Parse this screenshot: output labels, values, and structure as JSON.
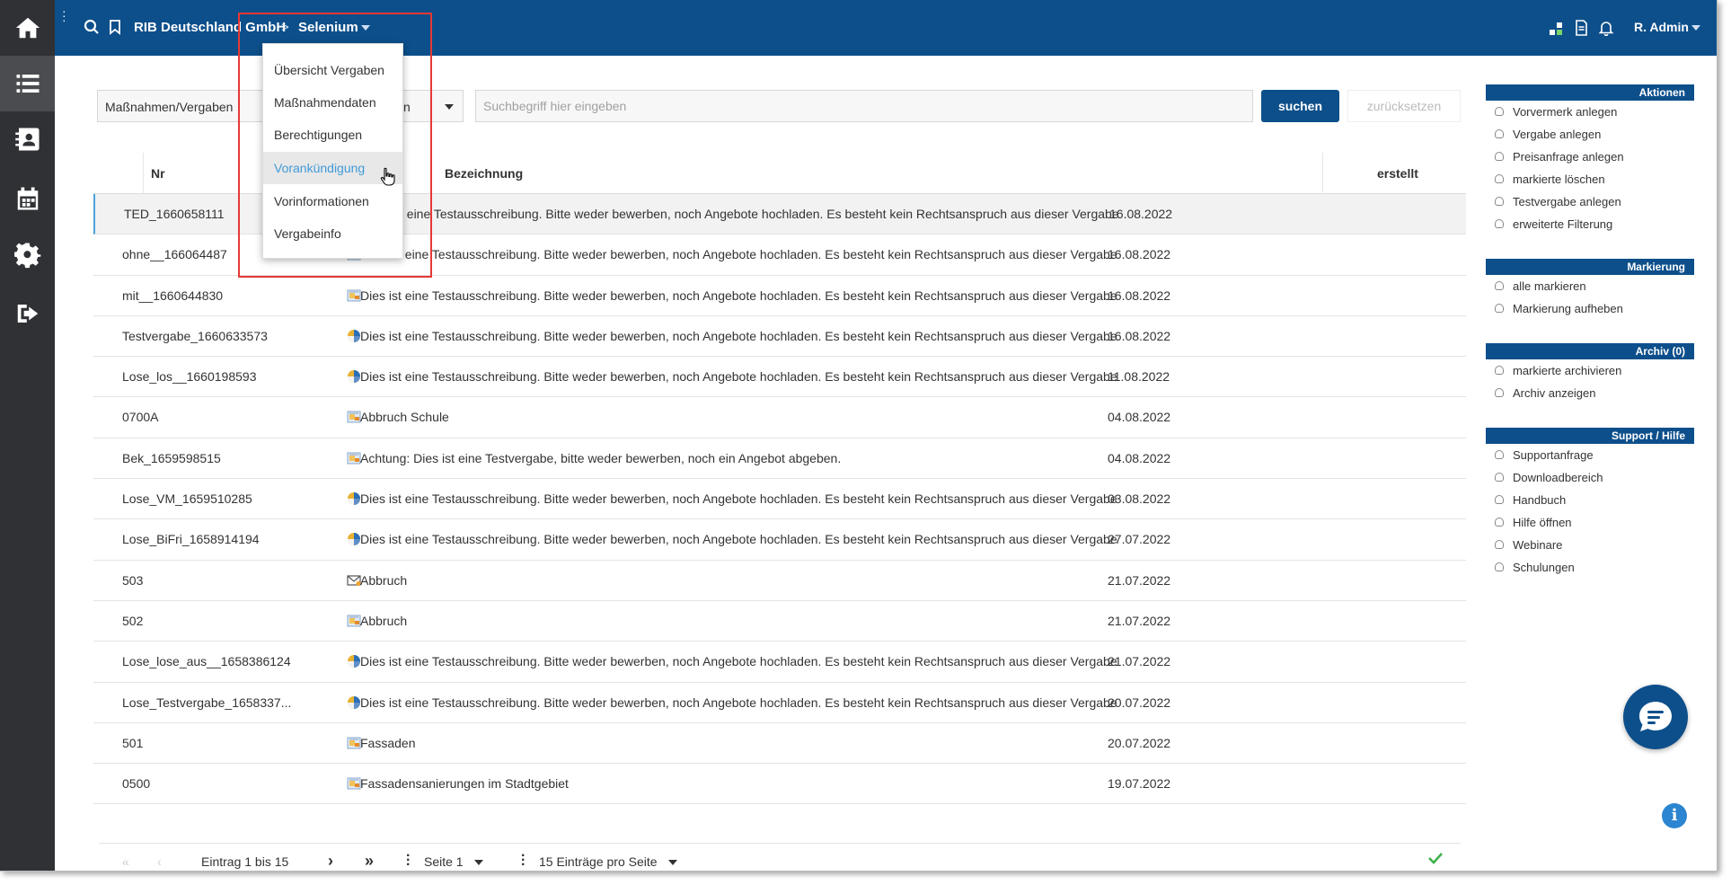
{
  "header": {
    "org": "RIB Deutschland GmbH",
    "separator": ">",
    "context": "Selenium",
    "user": "R. Admin"
  },
  "toolbar": {
    "filter_value": "Maßnahmen/Vergaben",
    "filter_value_tail": "n",
    "search_placeholder": "Suchbegriff hier eingeben",
    "search_label": "suchen",
    "reset_label": "zurücksetzen"
  },
  "dropdown": {
    "items": [
      "Übersicht Vergaben",
      "Maßnahmendaten",
      "Berechtigungen",
      "Vorankündigung",
      "Vorinformationen",
      "Vergabeinfo"
    ],
    "hovered": "Vorankündigung"
  },
  "table": {
    "columns": {
      "nr": "Nr",
      "bezeichnung": "Bezeichnung",
      "erstellt": "erstellt"
    },
    "rows": [
      {
        "nr": "TED_1660658111",
        "icon": "pie-icon",
        "bezeichnung": "Dies ist eine Testausschreibung. Bitte weder bewerben, noch Angebote hochladen. Es besteht kein Rechtsanspruch aus dieser Vergabe",
        "erstellt": "16.08.2022"
      },
      {
        "nr": "ohne__166064487",
        "icon": "folder-icon",
        "bezeichnung": "Dies ist eine Testausschreibung. Bitte weder bewerben, noch Angebote hochladen. Es besteht kein Rechtsanspruch aus dieser Vergabe",
        "erstellt": "16.08.2022"
      },
      {
        "nr": "mit__1660644830",
        "icon": "folder-icon",
        "bezeichnung": "Dies ist eine Testausschreibung. Bitte weder bewerben, noch Angebote hochladen. Es besteht kein Rechtsanspruch aus dieser Vergabe",
        "erstellt": "16.08.2022"
      },
      {
        "nr": "Testvergabe_1660633573",
        "icon": "pie-icon",
        "bezeichnung": "Dies ist eine Testausschreibung. Bitte weder bewerben, noch Angebote hochladen. Es besteht kein Rechtsanspruch aus dieser Vergabe",
        "erstellt": "16.08.2022"
      },
      {
        "nr": "Lose_los__1660198593",
        "icon": "pie-icon",
        "bezeichnung": "Dies ist eine Testausschreibung. Bitte weder bewerben, noch Angebote hochladen. Es besteht kein Rechtsanspruch aus dieser Vergabe",
        "erstellt": "11.08.2022"
      },
      {
        "nr": "0700A",
        "icon": "folder-icon",
        "bezeichnung": "Abbruch Schule",
        "erstellt": "04.08.2022"
      },
      {
        "nr": "Bek_1659598515",
        "icon": "folder-icon",
        "bezeichnung": "Achtung: Dies ist eine Testvergabe, bitte weder bewerben, noch ein Angebot abgeben.",
        "erstellt": "04.08.2022"
      },
      {
        "nr": "Lose_VM_1659510285",
        "icon": "pie-icon",
        "bezeichnung": "Dies ist eine Testausschreibung. Bitte weder bewerben, noch Angebote hochladen. Es besteht kein Rechtsanspruch aus dieser Vergabe",
        "erstellt": "03.08.2022"
      },
      {
        "nr": "Lose_BiFri_1658914194",
        "icon": "pie-icon",
        "bezeichnung": "Dies ist eine Testausschreibung. Bitte weder bewerben, noch Angebote hochladen. Es besteht kein Rechtsanspruch aus dieser Vergabe",
        "erstellt": "27.07.2022"
      },
      {
        "nr": "503",
        "icon": "envelope-icon",
        "bezeichnung": "Abbruch",
        "erstellt": "21.07.2022"
      },
      {
        "nr": "502",
        "icon": "folder-icon",
        "bezeichnung": "Abbruch",
        "erstellt": "21.07.2022"
      },
      {
        "nr": "Lose_lose_aus__1658386124",
        "icon": "pie-icon",
        "bezeichnung": "Dies ist eine Testausschreibung. Bitte weder bewerben, noch Angebote hochladen. Es besteht kein Rechtsanspruch aus dieser Vergabe",
        "erstellt": "21.07.2022"
      },
      {
        "nr": "Lose_Testvergabe_1658337...",
        "icon": "pie-icon",
        "bezeichnung": "Dies ist eine Testausschreibung. Bitte weder bewerben, noch Angebote hochladen. Es besteht kein Rechtsanspruch aus dieser Vergabe",
        "erstellt": "20.07.2022"
      },
      {
        "nr": "501",
        "icon": "folder-icon",
        "bezeichnung": "Fassaden",
        "erstellt": "20.07.2022"
      },
      {
        "nr": "0500",
        "icon": "folder-icon",
        "bezeichnung": "Fassadensanierungen im Stadtgebiet",
        "erstellt": "19.07.2022"
      }
    ]
  },
  "pager": {
    "range": "Eintrag 1 bis 15",
    "page": "Seite 1",
    "per_page": "15 Einträge pro Seite"
  },
  "sidebar": {
    "sections": [
      {
        "title": "Aktionen",
        "items": [
          "Vorvermerk anlegen",
          "Vergabe anlegen",
          "Preisanfrage anlegen",
          "markierte löschen",
          "Testvergabe anlegen",
          "erweiterte Filterung"
        ]
      },
      {
        "title": "Markierung",
        "items": [
          "alle markieren",
          "Markierung aufheben"
        ]
      },
      {
        "title": "Archiv (0)",
        "items": [
          "markierte archivieren",
          "Archiv anzeigen"
        ]
      },
      {
        "title": "Support / Hilfe",
        "items": [
          "Supportanfrage",
          "Downloadbereich",
          "Handbuch",
          "Hilfe öffnen",
          "Webinare",
          "Schulungen"
        ]
      }
    ]
  },
  "info_label": "i",
  "colors": {
    "header": "#0d4f8b",
    "nav": "#2f3135",
    "highlight": "#e53935",
    "link_hover": "#3f9ad8"
  }
}
